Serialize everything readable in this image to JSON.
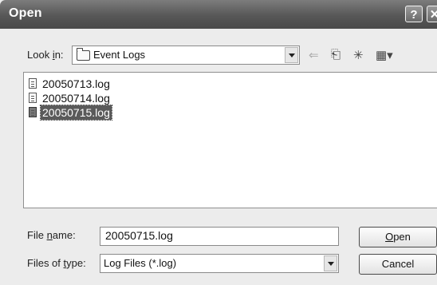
{
  "window": {
    "title": "Open",
    "help_glyph": "?",
    "close_glyph": "✕"
  },
  "lookin": {
    "label_pre": "Look ",
    "label_key": "i",
    "label_post": "n:",
    "folder": "Event Logs"
  },
  "toolbar": {
    "back_glyph": "⇐",
    "up_glyph": "⎗",
    "newfolder_glyph": "✳",
    "views_glyph": "▦▾"
  },
  "files": [
    {
      "name": "20050713.log",
      "selected": false
    },
    {
      "name": "20050714.log",
      "selected": false
    },
    {
      "name": "20050715.log",
      "selected": true
    }
  ],
  "filename": {
    "label_pre": "File ",
    "label_key": "n",
    "label_post": "ame:",
    "value": "20050715.log"
  },
  "filetype": {
    "label_pre": "Files of ",
    "label_key": "t",
    "label_post": "ype:",
    "value": "Log Files (*.log)"
  },
  "buttons": {
    "open_key": "O",
    "open_rest": "pen",
    "cancel": "Cancel"
  }
}
